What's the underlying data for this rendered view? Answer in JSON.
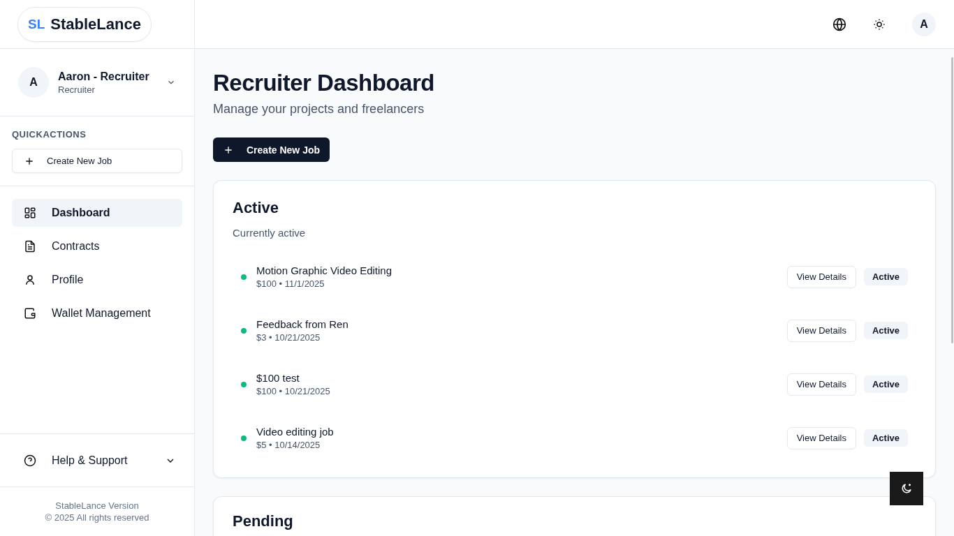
{
  "logo": {
    "mark": "SL",
    "name": "StableLance"
  },
  "header": {
    "avatar": "A"
  },
  "user": {
    "avatar": "A",
    "name": "Aaron - Recruiter",
    "role": "Recruiter"
  },
  "quick_actions": {
    "heading": "QUICKACTIONS",
    "button": "Create New Job"
  },
  "nav": [
    {
      "label": "Dashboard",
      "kind": "grid",
      "selected": true
    },
    {
      "label": "Contracts",
      "kind": "document",
      "selected": false
    },
    {
      "label": "Profile",
      "kind": "person",
      "selected": false
    },
    {
      "label": "Wallet Management",
      "kind": "wallet",
      "selected": false
    }
  ],
  "help": {
    "label": "Help & Support"
  },
  "footer": {
    "line_1": "StableLance Version",
    "line_2": "© 2025 All rights reserved"
  },
  "page": {
    "title": "Recruiter Dashboard",
    "subtitle": "Manage your projects and freelancers",
    "create_button": "Create New Job"
  },
  "active_section": {
    "title": "Active",
    "subtitle": "Currently active",
    "jobs": [
      {
        "title": "Motion Graphic Video Editing",
        "meta": "$100 • 11/1/2025",
        "color": "#10b981",
        "button": "View Details",
        "status": "Active"
      },
      {
        "title": "Feedback from Ren",
        "meta": "$3 • 10/21/2025",
        "color": "#10b981",
        "button": "View Details",
        "status": "Active"
      },
      {
        "title": "$100 test",
        "meta": "$100 • 10/21/2025",
        "color": "#10b981",
        "button": "View Details",
        "status": "Active"
      },
      {
        "title": "Video editing job",
        "meta": "$5 • 10/14/2025",
        "color": "#10b981",
        "button": "View Details",
        "status": "Active"
      }
    ]
  },
  "pending_section": {
    "title": "Pending"
  }
}
